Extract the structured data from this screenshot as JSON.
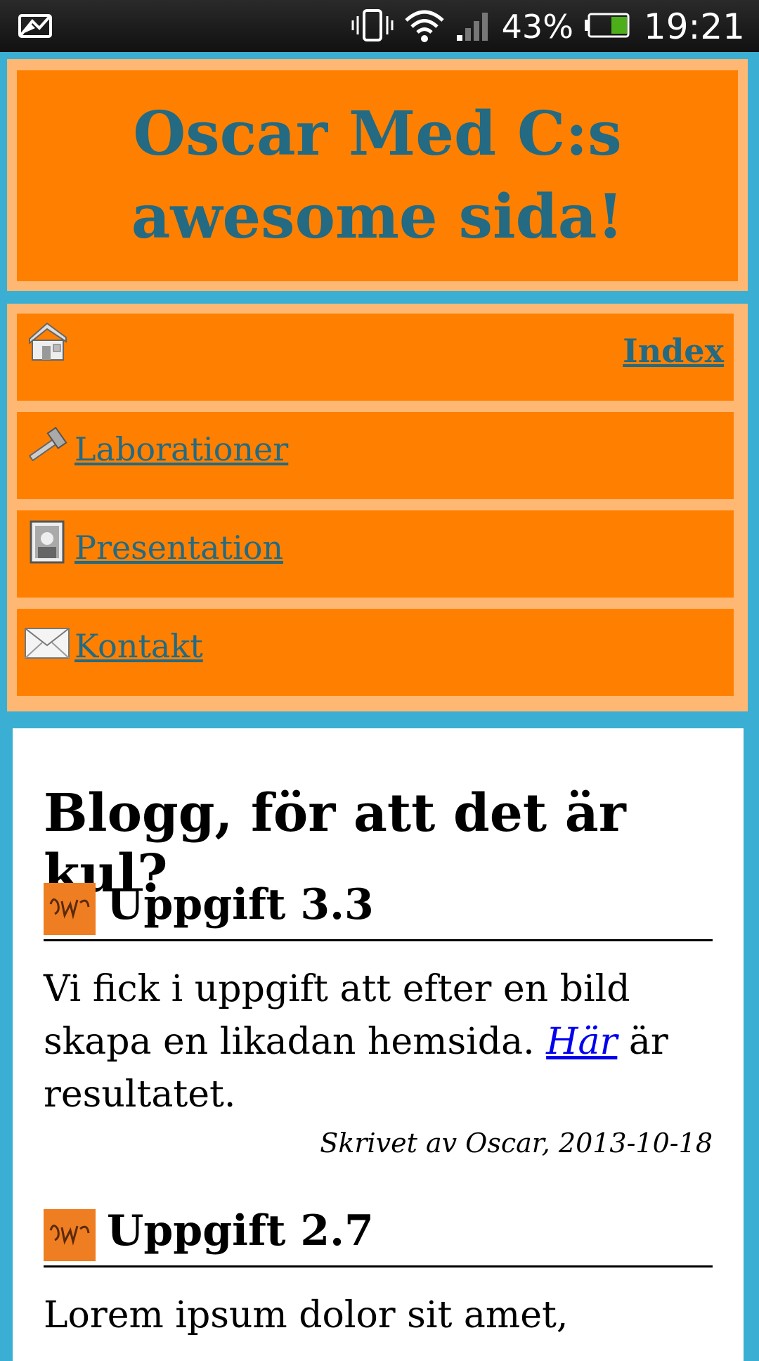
{
  "status_bar": {
    "battery_percent": "43%",
    "time": "19:21",
    "battery_level": 0.43,
    "accent": "#4caf19"
  },
  "header": {
    "title": "Oscar Med C:s awesome sida!",
    "title_color": "#236a82",
    "background": "#ff8000"
  },
  "nav": {
    "items": [
      {
        "label": "Index",
        "icon": "house-icon"
      },
      {
        "label": "Laborationer",
        "icon": "hammer-icon"
      },
      {
        "label": "Presentation",
        "icon": "portrait-icon"
      },
      {
        "label": "Kontakt",
        "icon": "envelope-icon"
      }
    ]
  },
  "content": {
    "heading": "Blogg, för att det är kul?",
    "posts": [
      {
        "title": "Uppgift 3.3",
        "icon": "signature-icon",
        "body_before": "Vi fick i uppgift att efter en bild skapa en likadan hemsida. ",
        "link_text": "Här",
        "body_after": " är resultatet.",
        "meta": "Skrivet av Oscar, 2013-10-18"
      },
      {
        "title": "Uppgift 2.7",
        "icon": "signature-icon",
        "body_before": "Lorem ipsum dolor sit amet,",
        "link_text": "",
        "body_after": "",
        "meta": ""
      }
    ]
  }
}
